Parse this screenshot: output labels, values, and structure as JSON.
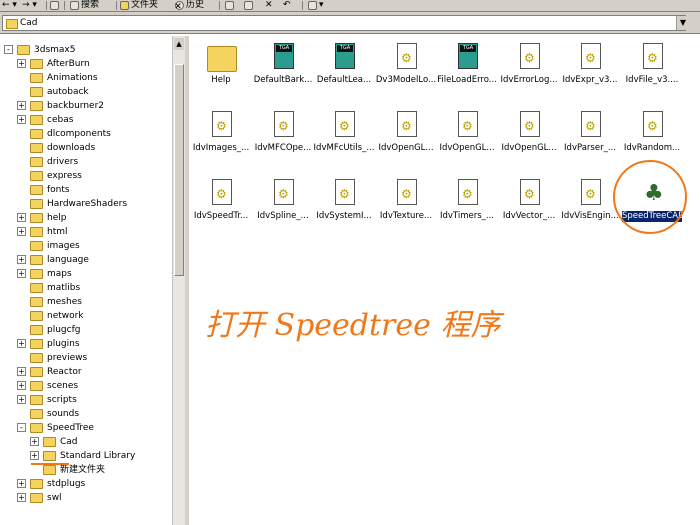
{
  "toolbar": {
    "search_label": "搜索",
    "folders_label": "文件夹",
    "history_label": "历史"
  },
  "address": {
    "value": "Cad"
  },
  "tree": {
    "items": [
      {
        "label": "3dsmax5",
        "expand": "-"
      },
      {
        "label": "AfterBurn",
        "expand": "+"
      },
      {
        "label": "Animations",
        "expand": ""
      },
      {
        "label": "autoback",
        "expand": ""
      },
      {
        "label": "backburner2",
        "expand": "+"
      },
      {
        "label": "cebas",
        "expand": "+"
      },
      {
        "label": "dlcomponents",
        "expand": ""
      },
      {
        "label": "downloads",
        "expand": ""
      },
      {
        "label": "drivers",
        "expand": ""
      },
      {
        "label": "express",
        "expand": ""
      },
      {
        "label": "fonts",
        "expand": ""
      },
      {
        "label": "HardwareShaders",
        "expand": ""
      },
      {
        "label": "help",
        "expand": "+"
      },
      {
        "label": "html",
        "expand": "+"
      },
      {
        "label": "images",
        "expand": ""
      },
      {
        "label": "language",
        "expand": "+"
      },
      {
        "label": "maps",
        "expand": "+"
      },
      {
        "label": "matlibs",
        "expand": ""
      },
      {
        "label": "meshes",
        "expand": ""
      },
      {
        "label": "network",
        "expand": ""
      },
      {
        "label": "plugcfg",
        "expand": ""
      },
      {
        "label": "plugins",
        "expand": "+"
      },
      {
        "label": "previews",
        "expand": ""
      },
      {
        "label": "Reactor",
        "expand": "+"
      },
      {
        "label": "scenes",
        "expand": "+"
      },
      {
        "label": "scripts",
        "expand": "+"
      },
      {
        "label": "sounds",
        "expand": ""
      },
      {
        "label": "SpeedTree",
        "expand": "-"
      },
      {
        "label": "Cad",
        "expand": "+"
      },
      {
        "label": "Standard Library",
        "expand": "+"
      },
      {
        "label": "新建文件夹",
        "expand": ""
      },
      {
        "label": "stdplugs",
        "expand": "+"
      },
      {
        "label": "swl",
        "expand": "+"
      }
    ]
  },
  "files": [
    {
      "name": "Help",
      "kind": "folder"
    },
    {
      "name": "DefaultBark...",
      "kind": "tga"
    },
    {
      "name": "DefaultLea...",
      "kind": "tga"
    },
    {
      "name": "Dv3ModelLo...",
      "kind": "dll"
    },
    {
      "name": "FileLoadErro...",
      "kind": "tga"
    },
    {
      "name": "IdvErrorLog...",
      "kind": "dll"
    },
    {
      "name": "IdvExpr_v3...",
      "kind": "dll"
    },
    {
      "name": "IdvFile_v3....",
      "kind": "dll"
    },
    {
      "name": "IdvImages_...",
      "kind": "dll"
    },
    {
      "name": "IdvMFCOpe...",
      "kind": "dll"
    },
    {
      "name": "IdvMFcUtils_...",
      "kind": "dll"
    },
    {
      "name": "IdvOpenGL...",
      "kind": "dll"
    },
    {
      "name": "IdvOpenGL...",
      "kind": "dll"
    },
    {
      "name": "IdvOpenGL...",
      "kind": "dll"
    },
    {
      "name": "IdvParser_...",
      "kind": "dll"
    },
    {
      "name": "IdvRandom...",
      "kind": "dll"
    },
    {
      "name": "IdvSpeedTr...",
      "kind": "dll"
    },
    {
      "name": "IdvSpline_...",
      "kind": "dll"
    },
    {
      "name": "IdvSystemI...",
      "kind": "dll"
    },
    {
      "name": "IdvTexture...",
      "kind": "dll"
    },
    {
      "name": "IdvTimers_...",
      "kind": "dll"
    },
    {
      "name": "IdvVector_...",
      "kind": "dll"
    },
    {
      "name": "IdvVisEngin...",
      "kind": "dll"
    },
    {
      "name": "SpeedTreeCAD.exe",
      "kind": "exe"
    }
  ],
  "annotation": {
    "text": "打开 Speedtree 程序"
  },
  "colors": {
    "annotation": "#f07818",
    "selection": "#0a246a"
  }
}
